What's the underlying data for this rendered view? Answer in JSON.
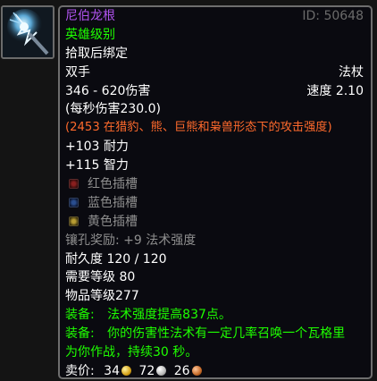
{
  "item": {
    "name": "尼伯龙根",
    "id_label": "ID: 50648",
    "quality": "英雄级别",
    "binding": "拾取后绑定",
    "slot": "双手",
    "type": "法杖",
    "damage": "346 - 620伤害",
    "speed": "速度 2.10",
    "dps": "(每秒伤害230.0)",
    "feral_ap": "(2453 在猎豹、熊、巨熊和枭兽形态下的攻击强度)",
    "stat1": "+103 耐力",
    "stat2": "+115 智力",
    "sockets": [
      {
        "label": "红色插槽",
        "color": "#8a1f1f"
      },
      {
        "label": "蓝色插槽",
        "color": "#2a4e90"
      },
      {
        "label": "黄色插槽",
        "color": "#b89d33"
      }
    ],
    "socket_bonus": "镶孔奖励: +9 法术强度",
    "durability": "耐久度 120 / 120",
    "req_level": "需要等级 80",
    "item_level": "物品等级277",
    "equip1_prefix": "装备:",
    "equip1_text": "法术强度提高837点。",
    "equip2_prefix": "装备:",
    "equip2_text_line1": "你的伤害性法术有一定几率召唤一个瓦格里",
    "equip2_text_line2": "为你作战，持续30 秒。",
    "sell": {
      "label": "卖价:",
      "gold": "34",
      "silver": "72",
      "copper": "26"
    }
  },
  "colors": {
    "epic": "#b154f0",
    "heroic": "#1eff00",
    "text": "#ffffff",
    "gray": "#8e8e8e",
    "feral": "#ff6a2c"
  },
  "icons": [
    "staff-item-icon",
    "red-socket-icon",
    "blue-socket-icon",
    "yellow-socket-icon",
    "gold-coin-icon",
    "silver-coin-icon",
    "copper-coin-icon"
  ]
}
